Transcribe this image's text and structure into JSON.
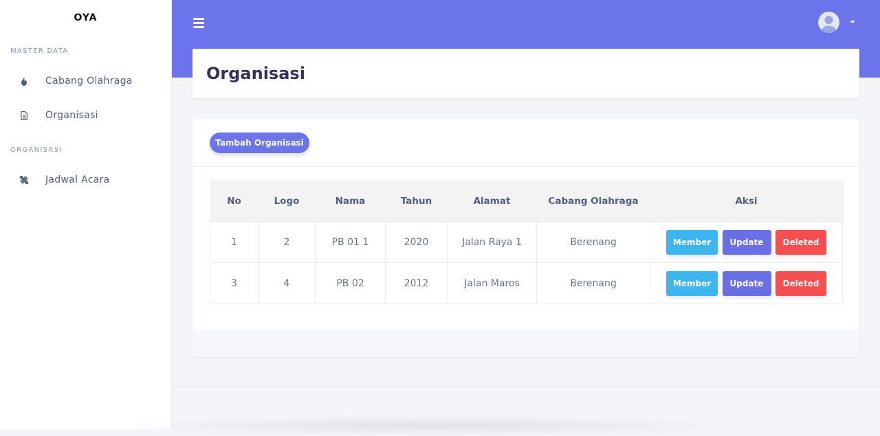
{
  "brand": "OYA",
  "sidebar": {
    "sections": [
      {
        "label": "MASTER DATA",
        "items": [
          {
            "label": "Cabang Olahraga",
            "icon": "fire-icon"
          },
          {
            "label": "Organisasi",
            "icon": "document-icon"
          }
        ]
      },
      {
        "label": "ORGANISASI",
        "items": [
          {
            "label": "Jadwal Acara",
            "icon": "tools-icon"
          }
        ]
      }
    ]
  },
  "header": {
    "menu_icon": "hamburger-icon",
    "avatar_icon": "user-avatar-icon",
    "caret_icon": "caret-down-icon"
  },
  "page": {
    "title": "Organisasi"
  },
  "toolbar": {
    "add_label": "Tambah Organisasi"
  },
  "table": {
    "headers": [
      "No",
      "Logo",
      "Nama",
      "Tahun",
      "Alamat",
      "Cabang Olahraga",
      "Aksi"
    ],
    "rows": [
      {
        "no": "1",
        "logo": "2",
        "nama": "PB 01 1",
        "tahun": "2020",
        "alamat": "Jalan Raya 1",
        "cabang": "Berenang"
      },
      {
        "no": "3",
        "logo": "4",
        "nama": "PB 02",
        "tahun": "2012",
        "alamat": "Jalan Maros",
        "cabang": "Berenang"
      }
    ],
    "actions": {
      "member": "Member",
      "update": "Update",
      "delete": "Deleted"
    }
  },
  "colors": {
    "primary": "#6b74ea",
    "info": "#3cb6ee",
    "danger": "#f5504f"
  }
}
